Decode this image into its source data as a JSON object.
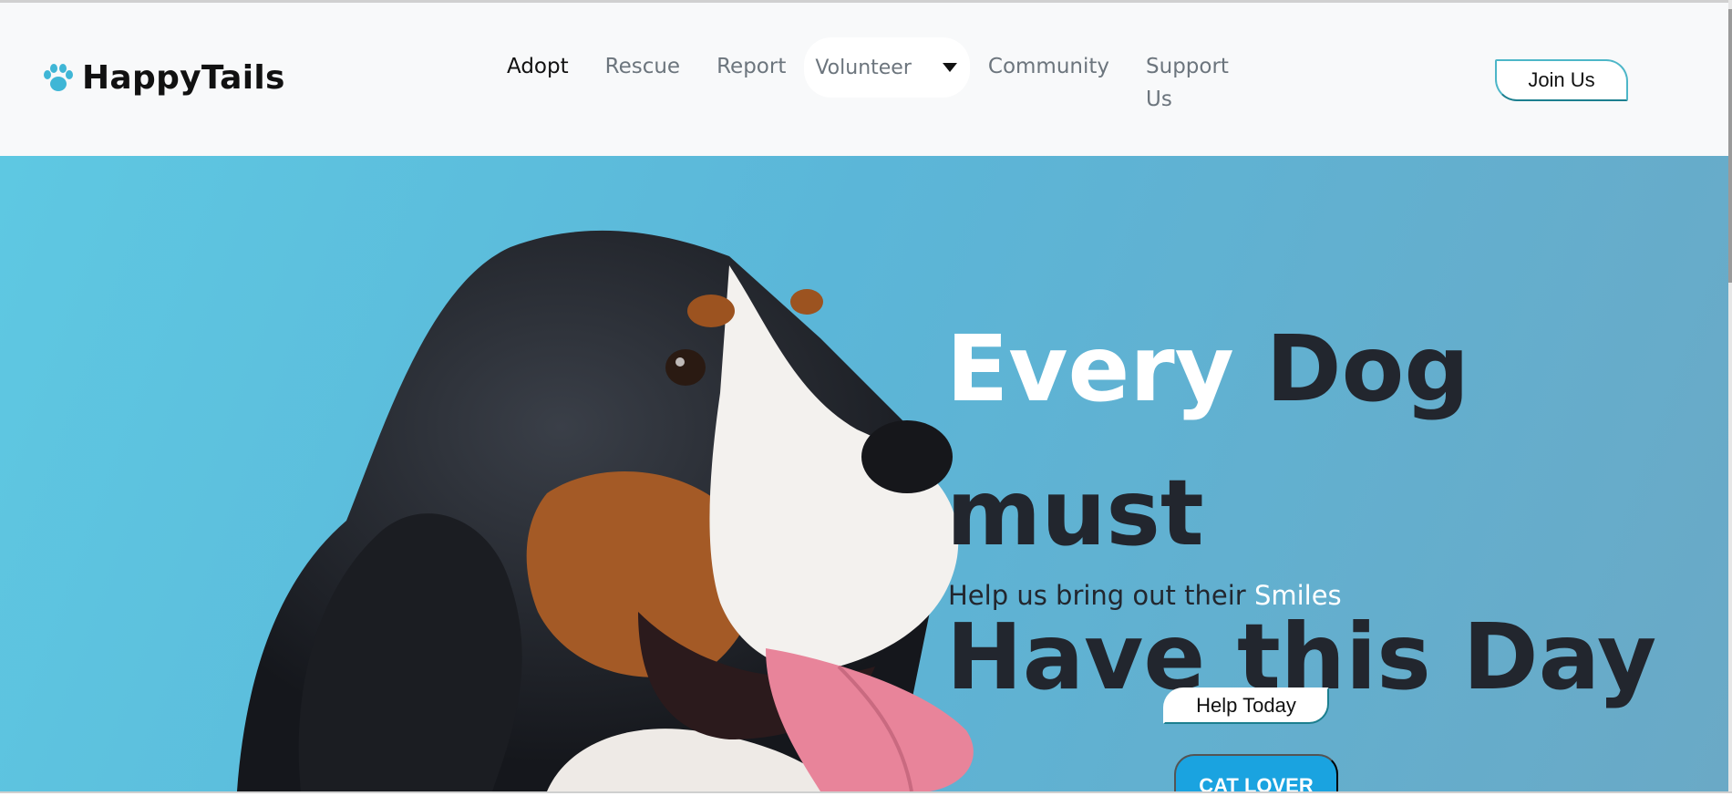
{
  "brand": {
    "name": "HappyTails",
    "icon": "paw-icon",
    "icon_color": "#3fb6d6"
  },
  "nav": {
    "items": [
      {
        "label": "Adopt",
        "active": true
      },
      {
        "label": "Rescue"
      },
      {
        "label": "Report"
      },
      {
        "label": "Volunteer",
        "dropdown": true
      },
      {
        "label": "Community"
      },
      {
        "label": "Support Us"
      }
    ],
    "join_label": "Join Us"
  },
  "hero": {
    "headline_part1": "Every",
    "headline_part2": " Dog must",
    "headline_line2": "Have this Day",
    "subline_part1": "Help us bring out their ",
    "subline_part2": "Smiles",
    "help_button": "Help Today",
    "cat_button": "CAT LOVER"
  },
  "colors": {
    "hero_bg": "#5bb6d8",
    "headline_dark": "#22262e",
    "accent": "#1aa3e0",
    "teal_border": "#1c7f8f"
  }
}
